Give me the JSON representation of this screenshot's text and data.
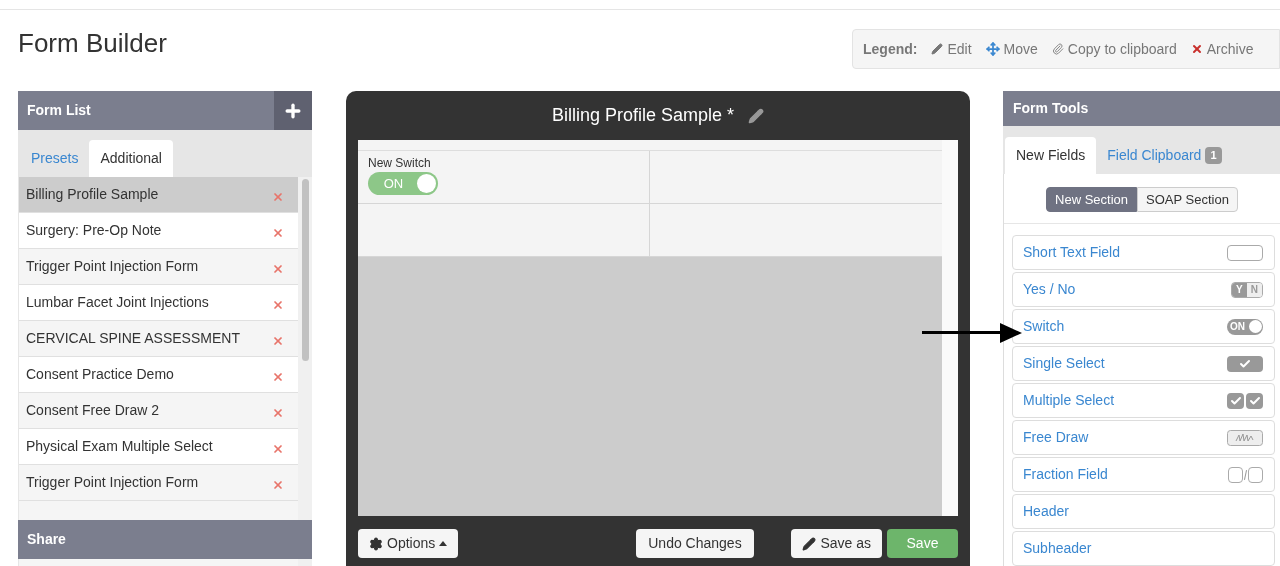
{
  "page_title": "Form Builder",
  "legend": {
    "label": "Legend:",
    "items": [
      {
        "kind": "edit",
        "label": "Edit"
      },
      {
        "kind": "move",
        "label": "Move"
      },
      {
        "kind": "copy",
        "label": "Copy to clipboard"
      },
      {
        "kind": "archive",
        "label": "Archive"
      }
    ]
  },
  "form_list": {
    "title": "Form List",
    "tabs": [
      {
        "label": "Presets",
        "selected": false
      },
      {
        "label": "Additional",
        "selected": true
      }
    ],
    "items": [
      {
        "label": "Billing Profile Sample",
        "selected": true
      },
      {
        "label": "Surgery: Pre-Op Note",
        "selected": false
      },
      {
        "label": "Trigger Point Injection Form",
        "selected": false
      },
      {
        "label": "Lumbar Facet Joint Injections",
        "selected": false
      },
      {
        "label": "CERVICAL SPINE ASSESSMENT",
        "selected": false
      },
      {
        "label": "Consent Practice Demo",
        "selected": false
      },
      {
        "label": "Consent Free Draw 2",
        "selected": false
      },
      {
        "label": "Physical Exam Multiple Select",
        "selected": false
      },
      {
        "label": "Trigger Point Injection Form",
        "selected": false
      }
    ]
  },
  "share": {
    "title": "Share"
  },
  "editor": {
    "title": "Billing Profile Sample *",
    "field": {
      "label": "New Switch",
      "on": true,
      "on_text": "ON"
    },
    "buttons": {
      "options": "Options",
      "undo": "Undo Changes",
      "save_as": "Save as",
      "save": "Save"
    }
  },
  "form_tools": {
    "title": "Form Tools",
    "tabs": [
      {
        "label": "New Fields",
        "selected": true
      },
      {
        "label": "Field Clipboard",
        "selected": false,
        "badge": "1"
      }
    ],
    "sections": [
      {
        "label": "New Section",
        "selected": true
      },
      {
        "label": "SOAP Section",
        "selected": false
      }
    ],
    "items": [
      {
        "label": "Short Text Field",
        "kind": "text"
      },
      {
        "label": "Yes / No",
        "kind": "yesno",
        "icon_labels": [
          "Y",
          "N"
        ]
      },
      {
        "label": "Switch",
        "kind": "switch",
        "icon_labels": [
          "ON"
        ]
      },
      {
        "label": "Single Select",
        "kind": "single"
      },
      {
        "label": "Multiple Select",
        "kind": "multi"
      },
      {
        "label": "Free Draw",
        "kind": "draw"
      },
      {
        "label": "Fraction Field",
        "kind": "fraction"
      },
      {
        "label": "Header",
        "kind": "plain"
      },
      {
        "label": "Subheader",
        "kind": "plain"
      }
    ]
  }
}
